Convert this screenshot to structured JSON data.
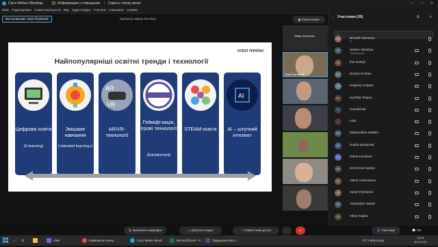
{
  "window": {
    "app_title": "Cisco Webex Meetings",
    "info_tab": "Информация о совещании",
    "hide_bar": "Скрыть строку меню",
    "minimize": "—",
    "maximize": "□",
    "close": "✕"
  },
  "menu": [
    "Файл",
    "Редактировать",
    "Совместный доступ",
    "Вид",
    "Аудио и видео",
    "Участник",
    "Совещание",
    "Справка"
  ],
  "speaker": {
    "label": "Выступающий:",
    "name": "Vasyl Shynkaruk"
  },
  "viewing_label": "Просмотр экрана Ihor Butj...",
  "slide": {
    "title": "Найпопулярніші освітні тренди і технології",
    "logo": "НУБіП УКРАЇНИ",
    "cards": [
      {
        "label": "Цифрова освіта",
        "sub": "(E-learning)"
      },
      {
        "label": "Змішане навчання",
        "sub": "(«blended learning»)"
      },
      {
        "label": "AR/VR-технології",
        "sub": ""
      },
      {
        "label": "Гейміфі-кація, ігрові технології",
        "sub": "(Edutainment)"
      },
      {
        "label": "STEAM-освіта",
        "sub": ""
      },
      {
        "label": "AI – штучний інтелект",
        "sub": ""
      }
    ],
    "icons": [
      "elearning-icon",
      "blended-learning-icon",
      "vr-headset-icon",
      "edutainment-badge-icon",
      "steam-icon",
      "ai-chip-icon"
    ],
    "ai_text": "AI"
  },
  "layout_button": "Компоновка",
  "thumbnails": [
    {
      "name": "Vitaliy Savchenko"
    },
    {
      "name": "Vasyl Shynkaruk"
    },
    {
      "name": ""
    },
    {
      "name": ""
    },
    {
      "name": ""
    },
    {
      "name": ""
    },
    {
      "name": ""
    }
  ],
  "panel": {
    "title": "Участники (35)",
    "participants": [
      {
        "initials": "ВС",
        "name": "Віталій Савченко",
        "role": "Я"
      },
      {
        "initials": "SV",
        "name": "Semen Voloshyn",
        "role": "Организатор"
      },
      {
        "initials": "IB",
        "name": "Ihor Butsyk",
        "role": ""
      },
      {
        "initials": "DK",
        "name": "Dmytro Kozhan",
        "role": ""
      },
      {
        "initials": "IA",
        "name": "Ievgeniy Antypov",
        "role": ""
      },
      {
        "initials": "KT",
        "name": "Kryzhka Tetiana",
        "role": ""
      },
      {
        "initials": "K",
        "name": "Kolodiichuk",
        "role": ""
      },
      {
        "initials": "L",
        "name": "Liliia",
        "role": ""
      },
      {
        "initials": "MN",
        "name": "Maiborodina Nataliia",
        "role": ""
      },
      {
        "initials": "NS",
        "name": "Nadiia Spodyniuk",
        "role": ""
      },
      {
        "initials": "OK",
        "name": "Olena Kovalova",
        "role": ""
      },
      {
        "initials": "SN",
        "name": "semenova Nadiya",
        "role": ""
      },
      {
        "initials": "VL",
        "name": "Valerii Lementarov",
        "role": ""
      },
      {
        "initials": "VS",
        "name": "Vasyl Shynkaruk",
        "role": ""
      },
      {
        "initials": "VV",
        "name": "Viacheslav Vasiuk",
        "role": ""
      },
      {
        "initials": "VK",
        "name": "Viktor Kaplun",
        "role": ""
      }
    ]
  },
  "controls": {
    "mic": "Выключить микрофон",
    "video": "Запустить видео",
    "share": "Совместный доступ",
    "participants": "Участники",
    "chat": "Чат"
  },
  "taskbar": {
    "items": [
      "Viber",
      "Керівництво учень...",
      "Cisco Webex Meeti...",
      "Microsoft Excel - P...",
      "Підвищення.docx ..."
    ],
    "weather": "9°C  Partly sunny",
    "time": "15:16",
    "date": "06.11.2021"
  },
  "colors": {
    "slide_card": "#1f3b78",
    "accent": "#4aa3df",
    "panel_bg": "#1b1b1b"
  }
}
